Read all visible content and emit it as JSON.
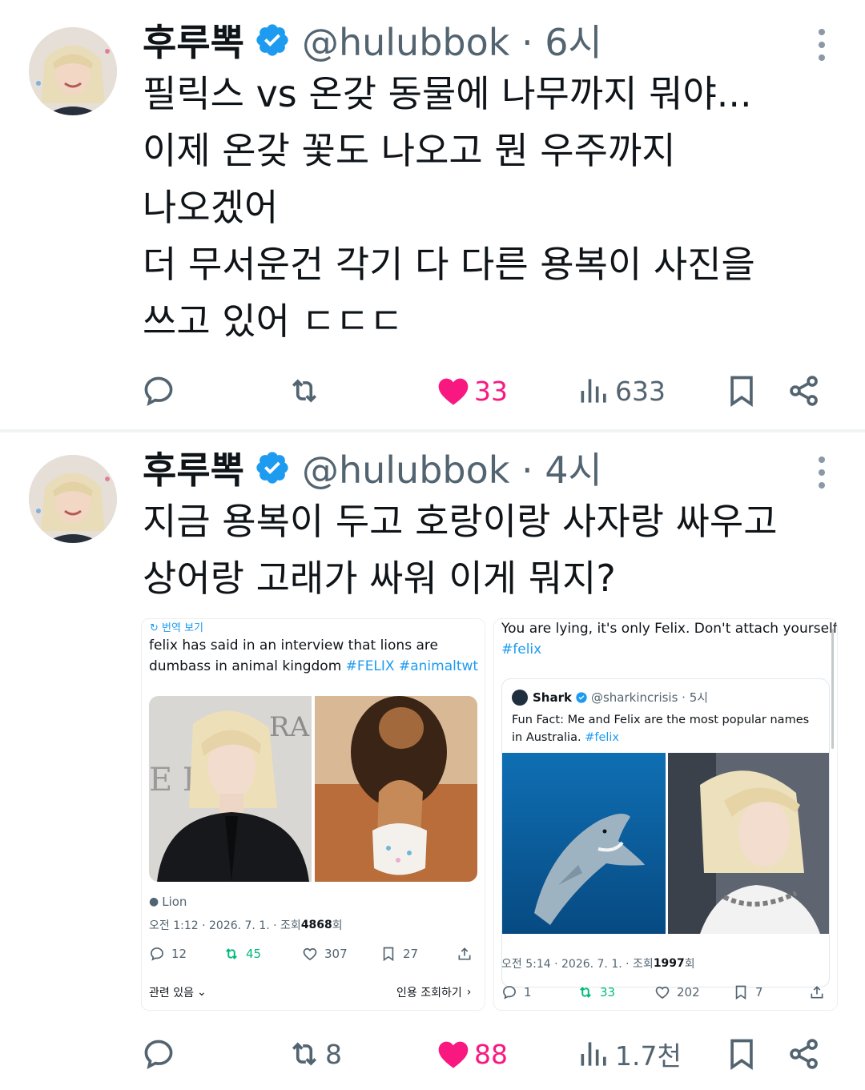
{
  "colors": {
    "accent": "#1d9bf0",
    "like": "#f91880",
    "text": "#0f1419",
    "muted": "#536471"
  },
  "tweets": [
    {
      "name": "후루뽁",
      "handle_time": "@hulubbok · 6시",
      "lines": [
        "필릭스 vs 온갖 동물에 나무까지 뭐야...",
        "이제 온갖 꽃도 나오고 뭔 우주까지",
        "나오겠어",
        "더 무서운건 각기 다 다른 용복이 사진을",
        "쓰고 있어 ㄷㄷㄷ"
      ],
      "likes": "33",
      "views": "633"
    },
    {
      "name": "후루뽁",
      "handle_time": "@hulubbok · 4시",
      "lines": [
        "지금 용복이 두고  호랑이랑 사자랑 싸우고",
        "상어랑 고래가 싸워 이게 뭐지?"
      ],
      "retweets": "8",
      "likes": "88",
      "views": "1.7천"
    }
  ],
  "quote_left": {
    "translate": "번역 보기",
    "text_line1": "felix has said in an interview that lions are",
    "text_line2_plain": "dumbass in animal kingdom ",
    "text_line2_tags": "#FELIX #animaltwt",
    "photo_sign": "E IC  IC",
    "photo_sign2": "RA",
    "author_label": "Lion",
    "meta_plain": "오전 1:12 · 2026. 7. 1. · 조회 ",
    "meta_views": "4868",
    "meta_suffix": "회",
    "replies": "12",
    "retweets": "45",
    "likes": "307",
    "bookmarks": "27",
    "related": "관련 있음",
    "quote_views": "인용 조회하기"
  },
  "quote_right": {
    "text": "You are lying, it's only Felix. Don't attach yourself.",
    "tag": "#felix",
    "inner_name": "Shark",
    "inner_handle_time": "@sharkincrisis · 5시",
    "inner_line1": "Fun Fact: Me and Felix are the most popular names",
    "inner_line2_plain": "in Australia. ",
    "inner_tag": "#felix",
    "meta_plain": "오전 5:14 · 2026. 7. 1. · 조회 ",
    "meta_views": "1997",
    "meta_suffix": "회",
    "replies": "1",
    "retweets": "33",
    "likes": "202",
    "bookmarks": "7"
  }
}
